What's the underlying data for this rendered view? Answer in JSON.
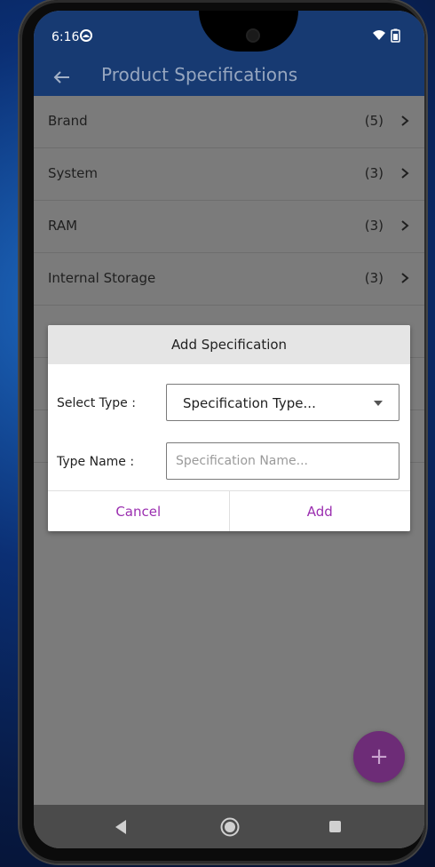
{
  "status": {
    "time": "6:16"
  },
  "appbar": {
    "title": "Product Specifications"
  },
  "list": {
    "items": [
      {
        "label": "Brand",
        "count": "(5)"
      },
      {
        "label": "System",
        "count": "(3)"
      },
      {
        "label": "RAM",
        "count": "(3)"
      },
      {
        "label": "Internal Storage",
        "count": "(3)"
      }
    ]
  },
  "dialog": {
    "title": "Add Specification",
    "select_type_label": "Select Type :",
    "select_value": "Specification Type...",
    "type_name_label": "Type Name :",
    "type_name_placeholder": "Specification Name...",
    "type_name_value": "",
    "cancel_label": "Cancel",
    "add_label": "Add"
  },
  "fab": {
    "label": "+"
  },
  "colors": {
    "appbar": "#173a72",
    "accent": "#9b2fb0",
    "fab": "#6d2c77",
    "scrim": "#7b7b7b"
  },
  "icons": {
    "back": "arrow-left-icon",
    "chevron": "chevron-right-icon",
    "dropdown": "caret-down-icon",
    "fab": "plus-icon",
    "nav": [
      "nav-back-icon",
      "nav-home-icon",
      "nav-recent-icon"
    ]
  }
}
